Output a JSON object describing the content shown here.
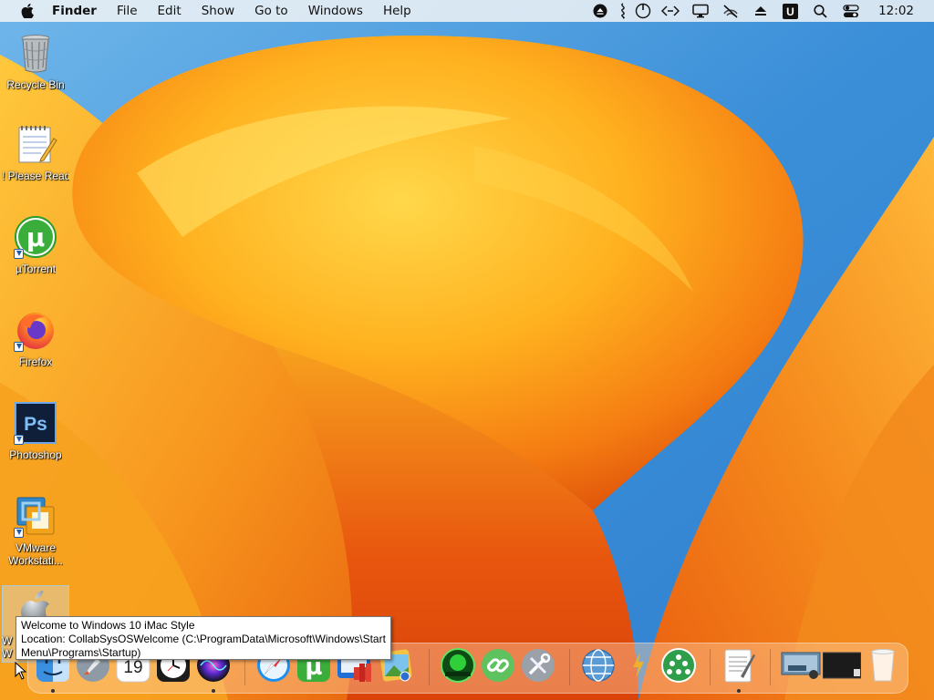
{
  "menubar": {
    "app_name": "Finder",
    "items": [
      "File",
      "Edit",
      "Show",
      "Go to",
      "Windows",
      "Help"
    ],
    "clock": "12:02",
    "tray_icons": [
      "eject-icon",
      "audio-icon",
      "power-icon",
      "code-icon",
      "display-icon",
      "mute-icon",
      "eject-triangle-icon",
      "u-app-icon",
      "search-icon",
      "control-center-icon"
    ]
  },
  "desktop": {
    "icons": [
      {
        "name": "recycle-bin",
        "label": "Recycle Bin",
        "icon": "trash-icon"
      },
      {
        "name": "please-read",
        "label": "! Please Read!",
        "icon": "notepad-icon"
      },
      {
        "name": "utorrent",
        "label": "µTorrent",
        "icon": "utorrent-icon"
      },
      {
        "name": "firefox",
        "label": "Firefox",
        "icon": "firefox-icon"
      },
      {
        "name": "photoshop",
        "label": "Photoshop",
        "icon": "photoshop-icon"
      },
      {
        "name": "vmware",
        "label": "VMware\nWorkstati...",
        "icon": "vmware-icon"
      },
      {
        "name": "welcome",
        "label": "W\nW",
        "icon": "apple-icon"
      }
    ]
  },
  "tooltip": {
    "line1": "Welcome to Windows 10 iMac Style",
    "line2": "Location: CollabSysOSWelcome (C:\\ProgramData\\Microsoft\\Windows\\Start",
    "line3": "Menu\\Programs\\Startup)"
  },
  "dock": {
    "calendar_day": "19",
    "items": [
      "finder-icon",
      "launchpad-icon",
      "calendar-icon",
      "clock-icon",
      "siri-icon",
      "safari-icon",
      "utorrent-icon",
      "mail-icon",
      "books-icon",
      "preview-icon",
      "hardwarehub-icon",
      "link-icon",
      "tools-icon",
      "globe-icon",
      "lightning-icon",
      "network-icon",
      "textedit-icon",
      "screenshot-icon",
      "terminal-icon",
      "trash-icon"
    ]
  },
  "colors": {
    "menubar_bg": "#f6f6f6",
    "wallpaper_sky": "#3b8fd8",
    "wallpaper_orange": "#f7941d",
    "wallpaper_yellow": "#ffd23f"
  }
}
